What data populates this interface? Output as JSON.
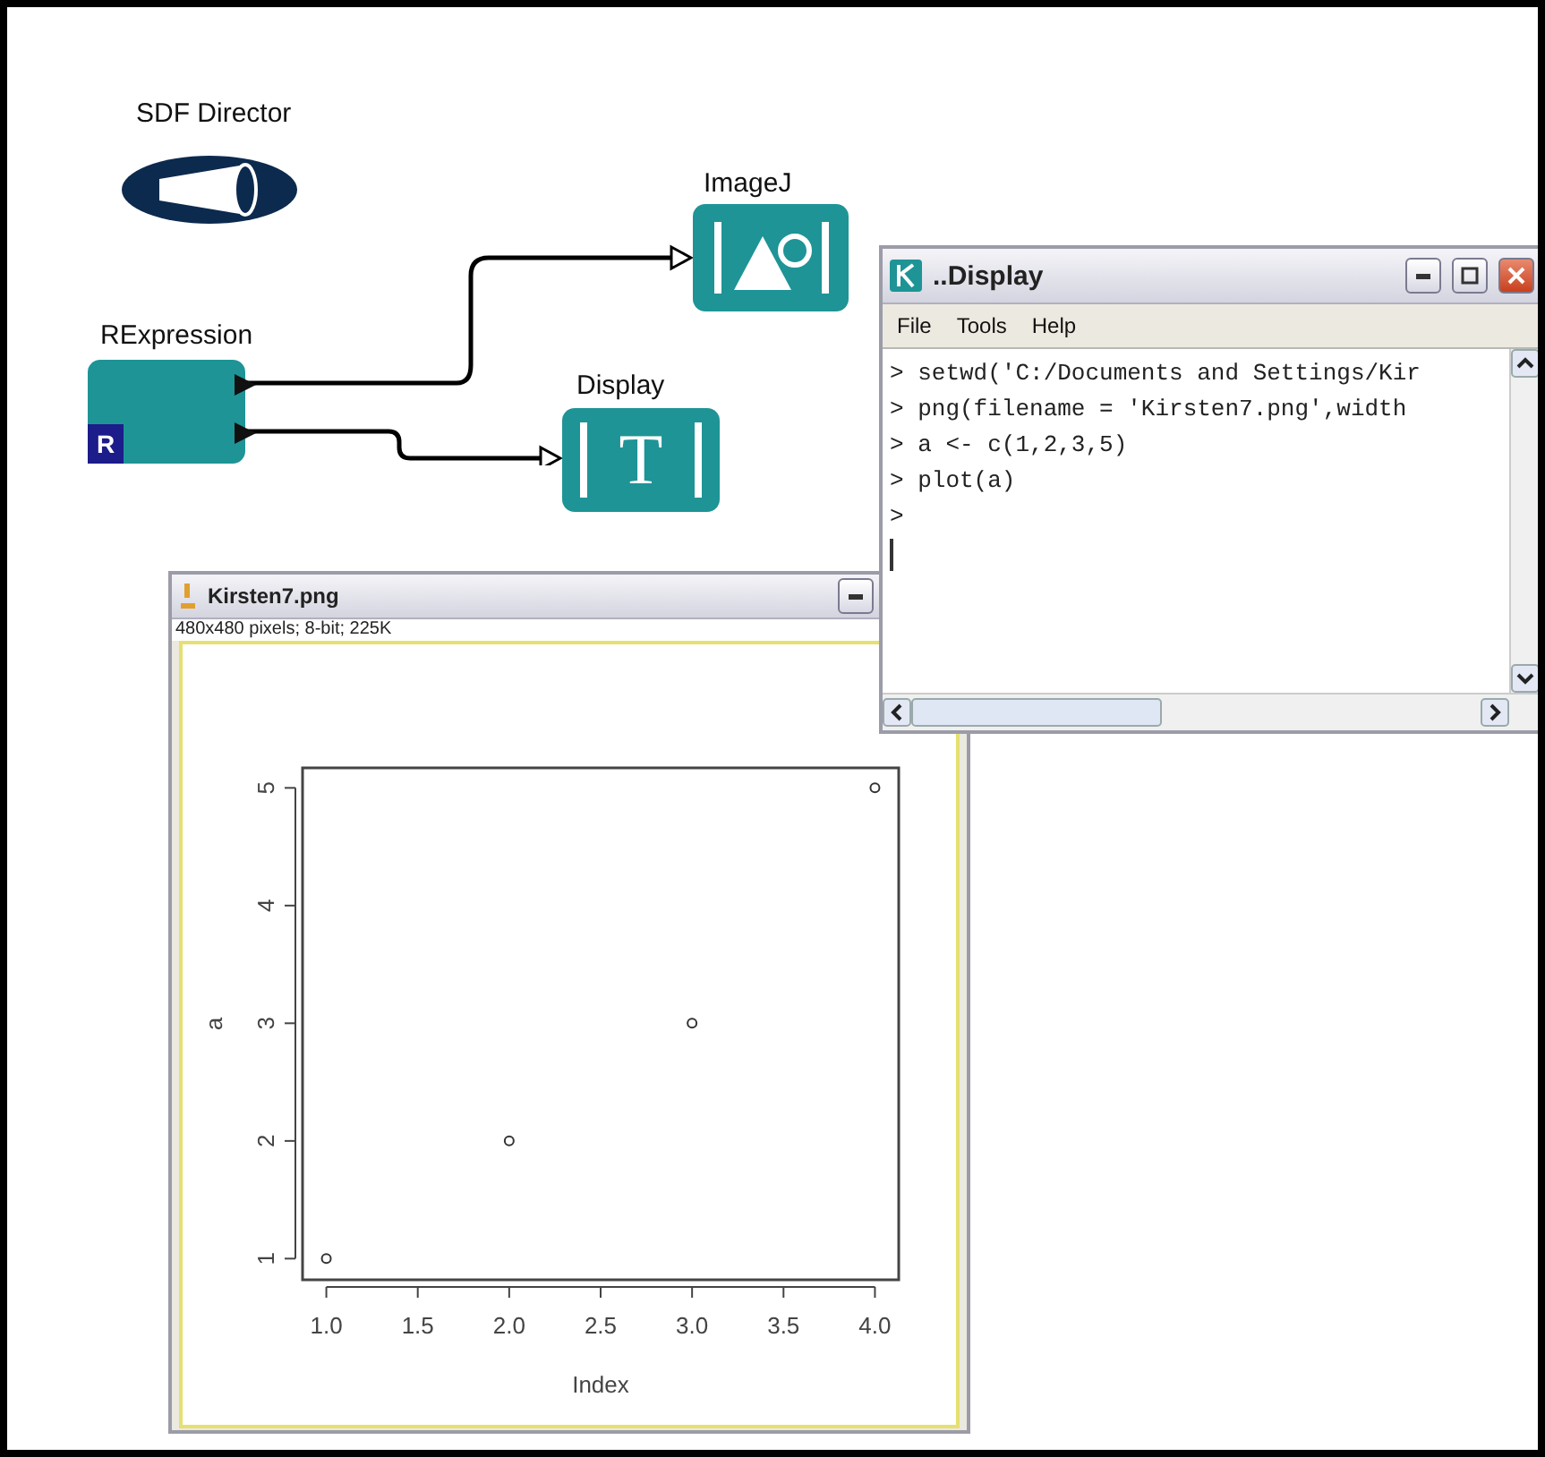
{
  "canvas": {
    "director": {
      "label": "SDF Director"
    },
    "actors": [
      {
        "label": "ImageJ",
        "kind": "image"
      },
      {
        "label": "RExpression",
        "kind": "r",
        "badge": "R"
      },
      {
        "label": "Display",
        "kind": "text",
        "icon_char": "T"
      }
    ]
  },
  "display_window": {
    "title": "..Display",
    "menu": [
      "File",
      "Tools",
      "Help"
    ],
    "lines": [
      "> setwd('C:/Documents and Settings/Kir",
      "> png(filename = 'Kirsten7.png',width",
      "> a <- c(1,2,3,5)",
      "> plot(a)",
      ">"
    ]
  },
  "image_window": {
    "title": "Kirsten7.png",
    "info": "480x480 pixels; 8-bit; 225K",
    "chart_data": {
      "type": "scatter",
      "xlabel": "Index",
      "ylabel": "a",
      "x": [
        1,
        2,
        3,
        4
      ],
      "series": [
        {
          "color": "#333333",
          "values": [
            1,
            2,
            3,
            5
          ]
        }
      ],
      "xlim": [
        0.87,
        4.13
      ],
      "ylim": [
        0.82,
        5.17
      ],
      "xticks": [
        {
          "value": 1,
          "label": "1.0"
        },
        {
          "value": 1.5,
          "label": "1.5"
        },
        {
          "value": 2,
          "label": "2.0"
        },
        {
          "value": 2.5,
          "label": "2.5"
        },
        {
          "value": 3,
          "label": "3.0"
        },
        {
          "value": 3.5,
          "label": "3.5"
        },
        {
          "value": 4,
          "label": "4.0"
        }
      ],
      "yticks": [
        1,
        2,
        3,
        4,
        5
      ]
    }
  }
}
